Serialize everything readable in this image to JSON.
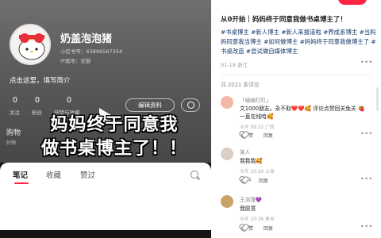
{
  "profile": {
    "username": "奶盖泡泡猪",
    "uid_text": "小红书号：63896567354",
    "ip_text": "IP属地：安徽",
    "bio": "点击这里，填写简介",
    "stats": [
      {
        "value": "0",
        "label": "关注"
      },
      {
        "value": "0",
        "label": "粉丝"
      },
      {
        "value": "0",
        "label": "获赞与收藏"
      }
    ],
    "edit_button": "编辑资料",
    "shop_label": "购物",
    "shop_sub": "好物",
    "avatar_icon": "hello-kitty-avatar",
    "settings_icon": "gear-icon"
  },
  "video": {
    "caption_line1": "妈妈终于同意我",
    "caption_line2": "做书桌博主了！！",
    "play_icon": "play-icon"
  },
  "profile_tabs": [
    {
      "label": "笔记",
      "active": true
    },
    {
      "label": "收藏",
      "active": false
    },
    {
      "label": "赞过",
      "active": false
    }
  ],
  "post": {
    "title": "从0开始｜妈妈终于同意我做书桌博主了！",
    "tags": "#书桌博主 #新人博主 #新人来报道啦 #养成系博主 #当妈妈同意我当博主 #如何做博主 #妈妈终于同意我做博主了 #书桌改造 #尝试做自媒体博主",
    "meta": "01-19 浙江",
    "comments_count": "共 2021 条评论",
    "more_icon": "more-dots-icon"
  },
  "comments": [
    {
      "name": "「嘀嘀叮叮」",
      "text_line1": "文1000朋友。永不取❤️❤️🥰 评论点赞回关免关 🍓",
      "text_line2": "一直在线哈🥰",
      "time": "今天 09:22 广西",
      "likes": "赞",
      "reply": "回复",
      "avatar_color": "#f2b8a6"
    },
    {
      "name": "某人",
      "text_line1": "我我我🥰",
      "time": "今天 10:20 上海",
      "likes": "1",
      "reply": "回复",
      "avatar_color": "#d9cfc7"
    },
    {
      "name": "王浩瑾💜",
      "text_line1": "我愿意",
      "time": "今天 10:36 贵州",
      "likes": "赞",
      "reply": "回复",
      "avatar_color": "#c9a36a"
    }
  ],
  "colors": {
    "accent": "#ff2442",
    "tag": "#13386c"
  }
}
